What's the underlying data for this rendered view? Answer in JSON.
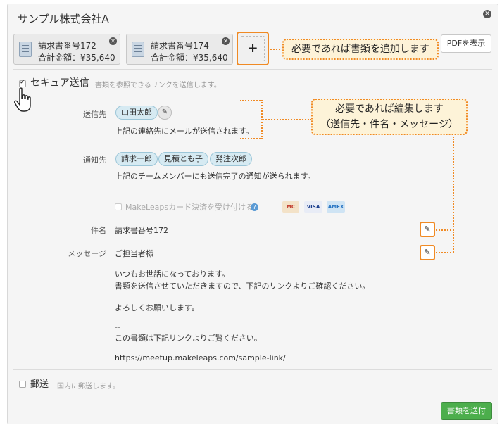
{
  "dialog": {
    "title": "サンプル株式会社A",
    "close_symbol": "✕"
  },
  "documents": [
    {
      "name": "請求書番号172",
      "amount": "合計金額：¥35,640"
    },
    {
      "name": "請求書番号174",
      "amount": "合計金額：¥35,640"
    }
  ],
  "add_button": {
    "label": "+"
  },
  "pdf_button": {
    "label": "PDFを表示"
  },
  "callouts": {
    "add": "必要であれば書類を追加します",
    "edit_line1": "必要であれば編集します",
    "edit_line2": "（送信先・件名・メッセージ）"
  },
  "secure": {
    "label": "セキュア送信",
    "description": "書類を参照できるリンクを送信します。",
    "checked": true
  },
  "recipients": {
    "label": "送信先",
    "contact": "山田太郎",
    "note": "上記の連絡先にメールが送信されます。"
  },
  "notify": {
    "label": "通知先",
    "members": [
      "請求一郎",
      "見積とも子",
      "発注次郎"
    ],
    "note": "上記のチームメンバーにも送信完了の通知が送られます。"
  },
  "payment": {
    "label": "MakeLeapsカード決済を受け付ける",
    "cards": [
      "MC",
      "VISA",
      "AMEX"
    ]
  },
  "subject": {
    "label": "件名",
    "value": "請求書番号172"
  },
  "message": {
    "label": "メッセージ",
    "lines": [
      "ご担当者様",
      "いつもお世話になっております。",
      "書類を送信させていただきますので、下記のリンクよりご確認ください。",
      "よろしくお願いします。",
      "--",
      "この書類は下記リンクよりご覧ください。",
      "https://meetup.makeleaps.com/sample-link/"
    ]
  },
  "postal": {
    "label": "郵送",
    "description": "国内に郵送します。",
    "checked": false
  },
  "send_button": {
    "label": "書類を送付"
  },
  "colors": {
    "accent": "#f08a24",
    "callout_bg": "#fdf3d8",
    "pill_bg": "#d6eaf2",
    "send_green": "#4cae4c"
  }
}
